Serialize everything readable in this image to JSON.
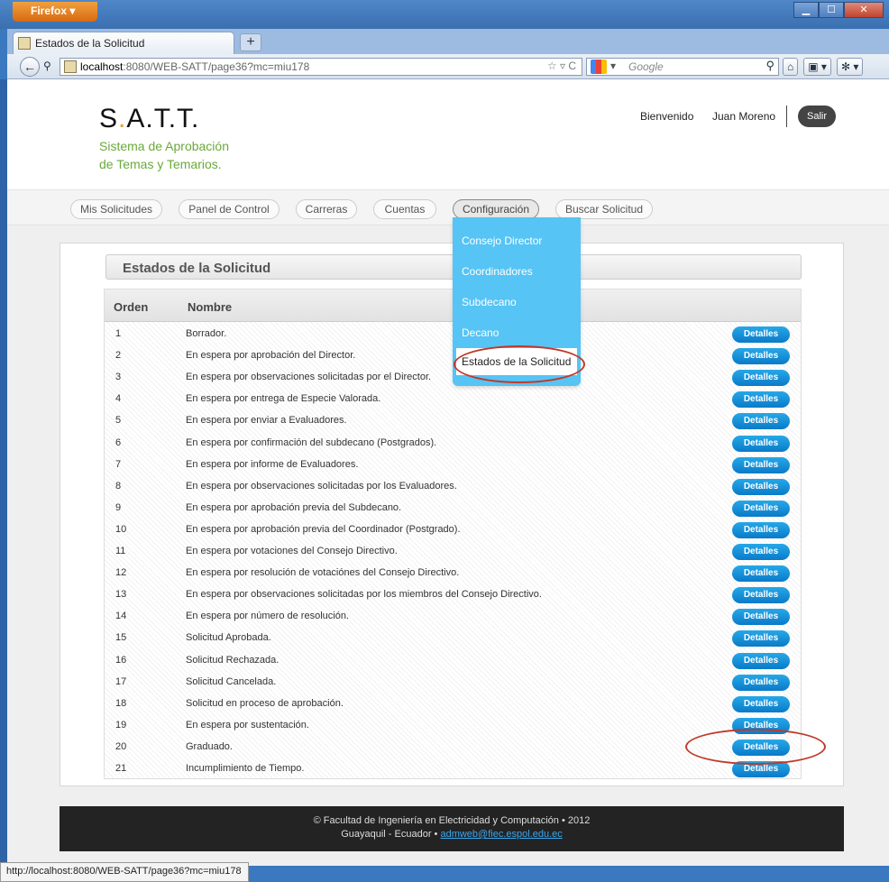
{
  "browser": {
    "app_button": "Firefox ▾",
    "tab_title": "Estados de la Solicitud",
    "new_tab": "+",
    "url_host": "localhost",
    "url_path": ":8080/WEB-SATT/page36?mc=miu178",
    "url_tools": "☆ ▿ C",
    "search_placeholder": "Google",
    "status_text": "http://localhost:8080/WEB-SATT/page36?mc=miu178",
    "window_controls": {
      "minimize": "▁",
      "maximize": "☐",
      "close": "✕"
    }
  },
  "header": {
    "logo_s": "S",
    "logo_a": "A",
    "logo_tt": "T.T.",
    "logo_dot": ".",
    "subtitle_line1": "Sistema de Aprobación",
    "subtitle_line2": "de Temas y Temarios.",
    "welcome": "Bienvenido",
    "user": "Juan Moreno",
    "logout": "Salir"
  },
  "menu": {
    "items": [
      "Mis Solicitudes",
      "Panel de Control",
      "Carreras",
      "Cuentas",
      "Configuración",
      "Buscar Solicitud"
    ],
    "dropdown": [
      "Consejo Director",
      "Coordinadores",
      "Subdecano",
      "Decano",
      "Estados de la Solicitud"
    ]
  },
  "section_title": "Estados de la Solicitud",
  "table": {
    "headers": [
      "Orden",
      "Nombre"
    ],
    "action_label": "Detalles",
    "rows": [
      {
        "orden": "1",
        "nombre": "Borrador."
      },
      {
        "orden": "2",
        "nombre": "En espera por aprobación del Director."
      },
      {
        "orden": "3",
        "nombre": "En espera por observaciones solicitadas por el Director."
      },
      {
        "orden": "4",
        "nombre": "En espera por entrega de Especie Valorada."
      },
      {
        "orden": "5",
        "nombre": "En espera por enviar a Evaluadores."
      },
      {
        "orden": "6",
        "nombre": "En espera por confirmación del subdecano (Postgrados)."
      },
      {
        "orden": "7",
        "nombre": "En espera por informe de Evaluadores."
      },
      {
        "orden": "8",
        "nombre": "En espera por observaciones solicitadas por los Evaluadores."
      },
      {
        "orden": "9",
        "nombre": "En espera por aprobación previa del Subdecano."
      },
      {
        "orden": "10",
        "nombre": "En espera por aprobación previa del Coordinador (Postgrado)."
      },
      {
        "orden": "11",
        "nombre": "En espera por votaciones del Consejo Directivo."
      },
      {
        "orden": "12",
        "nombre": "En espera por resolución de votaciónes del Consejo Directivo."
      },
      {
        "orden": "13",
        "nombre": "En espera por observaciones solicitadas por los miembros del Consejo Directivo."
      },
      {
        "orden": "14",
        "nombre": "En espera por número de resolución."
      },
      {
        "orden": "15",
        "nombre": "Solicitud Aprobada."
      },
      {
        "orden": "16",
        "nombre": "Solicitud Rechazada."
      },
      {
        "orden": "17",
        "nombre": "Solicitud Cancelada."
      },
      {
        "orden": "18",
        "nombre": "Solicitud en proceso de aprobación."
      },
      {
        "orden": "19",
        "nombre": "En espera por sustentación."
      },
      {
        "orden": "20",
        "nombre": "Graduado."
      },
      {
        "orden": "21",
        "nombre": "Incumplimiento de Tiempo."
      }
    ]
  },
  "footer": {
    "line1": "© Facultad de Ingeniería en Electricidad y Computación • 2012",
    "line2_prefix": "Guayaquil - Ecuador • ",
    "email": "admweb@fiec.espol.edu.ec"
  },
  "colors": {
    "accent": "#56c4f4",
    "button": "#0a7ac8",
    "logo_green": "#6aa93a",
    "logo_orange": "#e2a020",
    "annotation": "#c0392b"
  }
}
